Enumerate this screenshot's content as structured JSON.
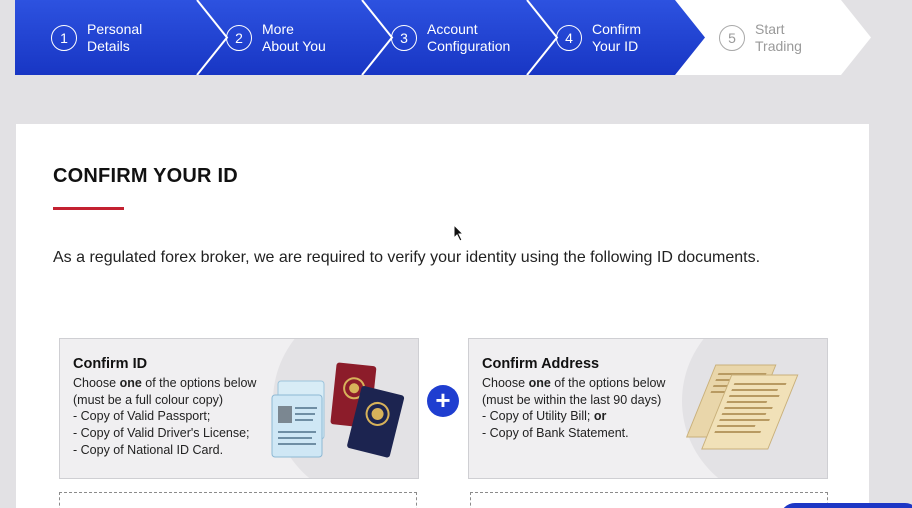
{
  "steps": [
    {
      "num": "1",
      "label": "Personal\nDetails",
      "state": "done"
    },
    {
      "num": "2",
      "label": "More\nAbout You",
      "state": "done"
    },
    {
      "num": "3",
      "label": "Account\nConfiguration",
      "state": "done"
    },
    {
      "num": "4",
      "label": "Confirm\nYour ID",
      "state": "active"
    },
    {
      "num": "5",
      "label": "Start\nTrading",
      "state": "pending"
    }
  ],
  "page": {
    "title": "CONFIRM YOUR ID",
    "intro": "As a regulated forex broker, we are required to verify your identity using the following ID documents."
  },
  "confirm_id": {
    "heading": "Confirm ID",
    "line1_pre": "Choose ",
    "line1_bold": "one",
    "line1_post": " of the options below",
    "line2": "(must be a full colour copy)",
    "items": [
      "- Copy of Valid Passport;",
      "- Copy of Valid Driver's License;",
      "- Copy of National ID Card."
    ],
    "art_icon": "id-cards-passports-icon"
  },
  "confirm_address": {
    "heading": "Confirm Address",
    "line1_pre": "Choose ",
    "line1_bold": "one",
    "line1_post": " of the options below",
    "line2": "(must be within the last 90 days)",
    "item1": "- Copy of Utility Bill; ",
    "item1_bold": "or",
    "item2": "- Copy of Bank Statement.",
    "art_icon": "bank-statements-icon"
  },
  "plus_symbol": "+",
  "colors": {
    "accent": "#1f3ed0",
    "rule": "#c32131",
    "pending": "#ffffff"
  }
}
